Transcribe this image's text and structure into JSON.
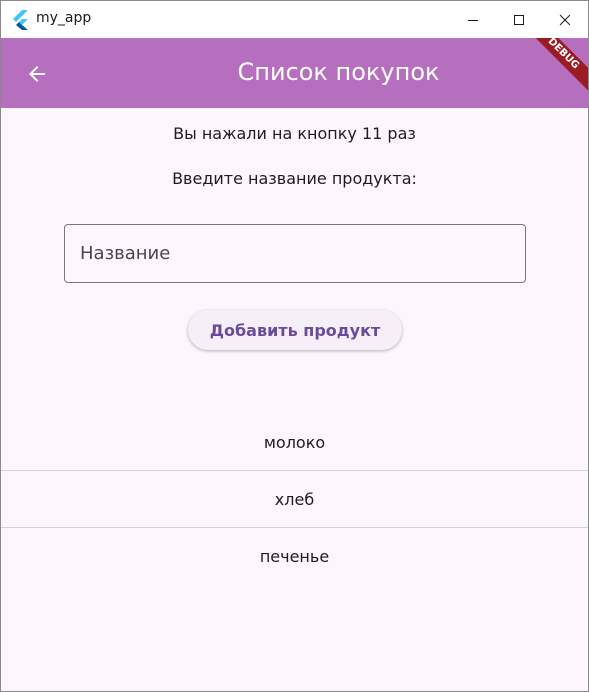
{
  "window": {
    "title": "my_app"
  },
  "appbar": {
    "title": "Список покупок",
    "debug_label": "DEBUG"
  },
  "main": {
    "counter_text": "Вы нажали на кнопку 11 раз",
    "prompt_text": "Введите название продукта:",
    "input_placeholder": "Название",
    "input_value": "",
    "add_button_label": "Добавить продукт"
  },
  "products": [
    "молоко",
    "хлеб",
    "печенье"
  ],
  "colors": {
    "appbar": "#b56fbe",
    "background": "#fdf7fd",
    "accent_text": "#6a4a9a",
    "debug_banner": "#9a1b21"
  }
}
